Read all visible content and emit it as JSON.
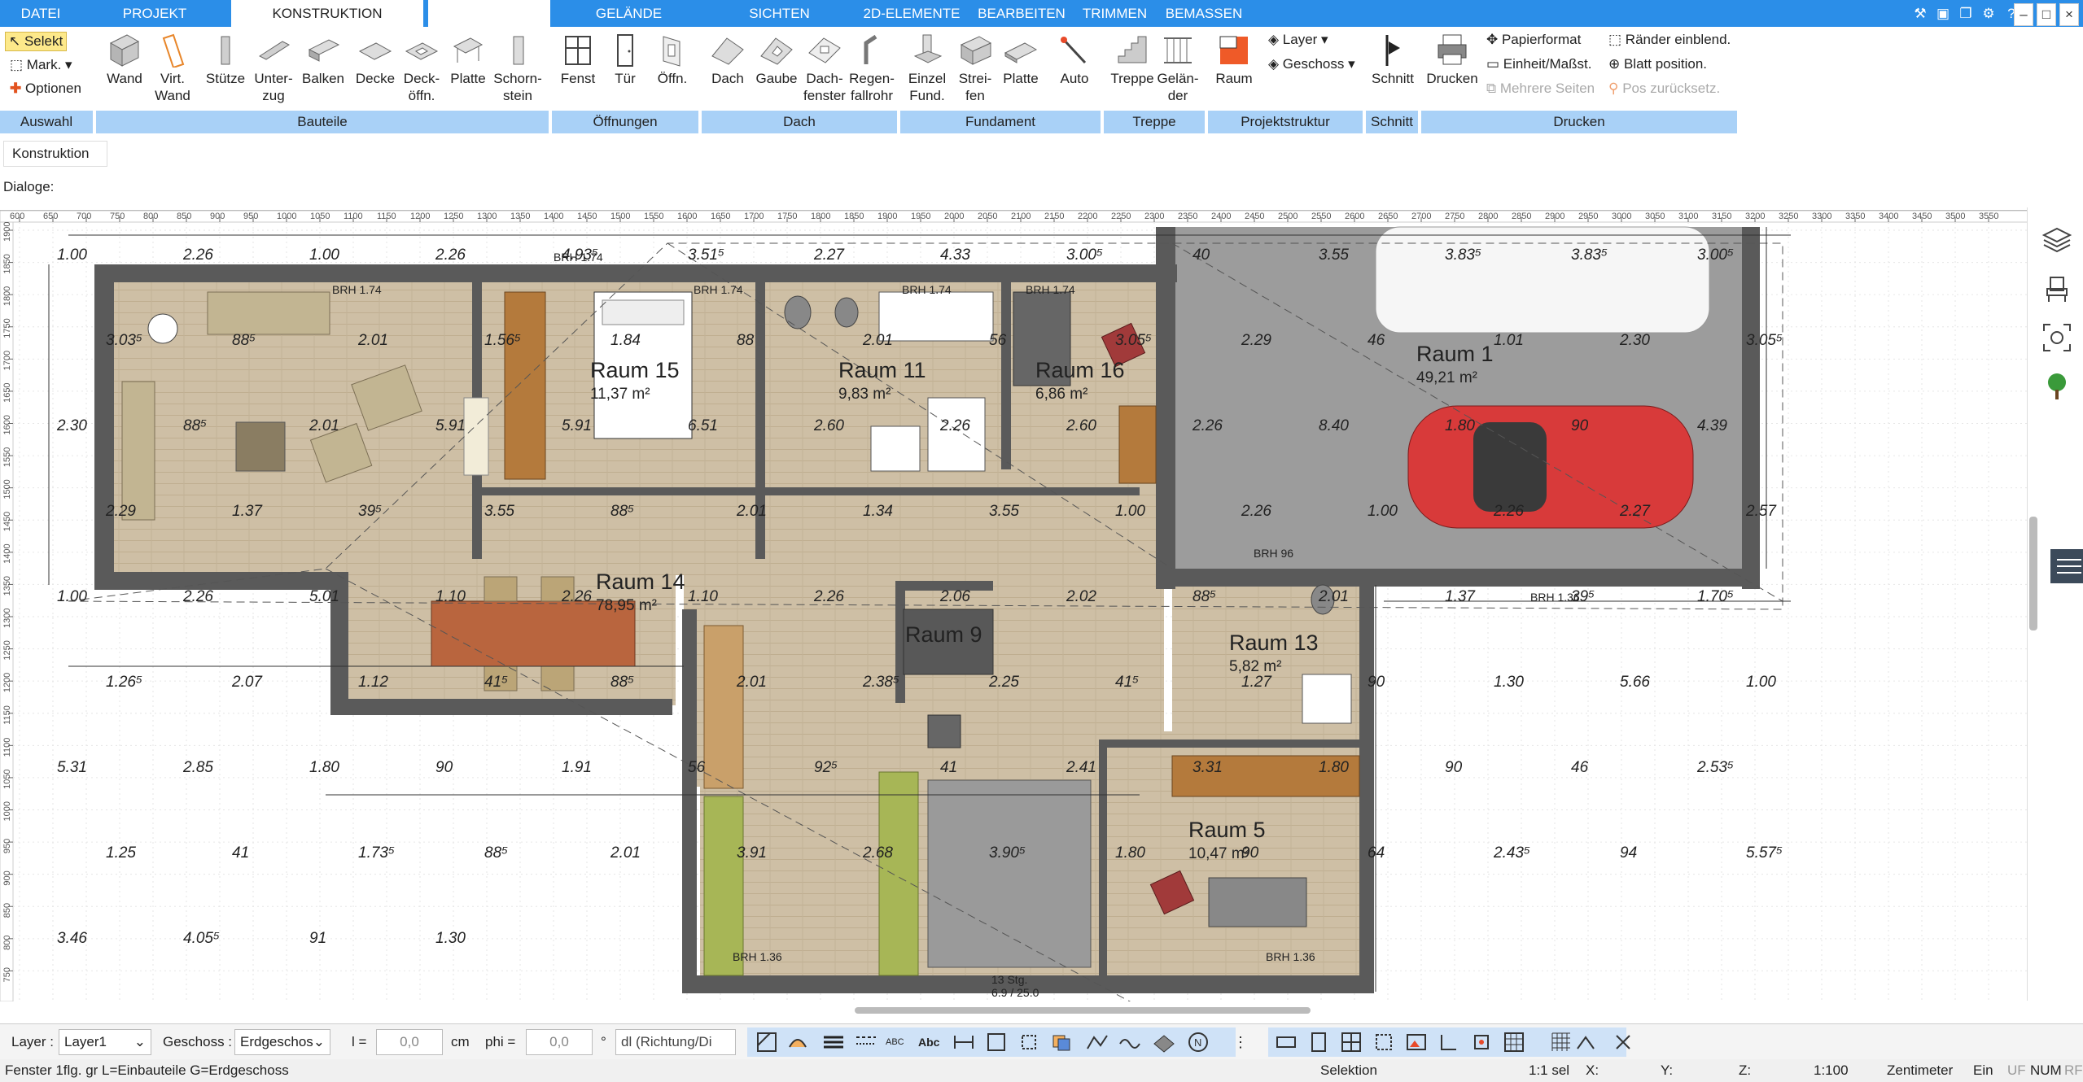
{
  "tabs": {
    "datei": "DATEI",
    "projekt": "PROJEKT",
    "konstruktion": "KONSTRUKTION",
    "gelaende": "GELÄNDE",
    "sichten": "SICHTEN",
    "elemente2d": "2D-ELEMENTE",
    "bearbeiten": "BEARBEITEN",
    "trimmen": "TRIMMEN",
    "bemassen": "BEMASSEN"
  },
  "ribbon": {
    "auswahl": {
      "selekt": "Selekt",
      "mark": "Mark.",
      "optionen": "Optionen"
    },
    "bauteile": {
      "wand": "Wand",
      "virt_wand_1": "Virt.",
      "virt_wand_2": "Wand",
      "stuetze": "Stütze",
      "unterzug_1": "Unter-",
      "unterzug_2": "zug",
      "balken": "Balken",
      "decke": "Decke",
      "deckoeffn_1": "Deck-",
      "deckoeffn_2": "öffn.",
      "platte": "Platte",
      "schornstein_1": "Schorn-",
      "schornstein_2": "stein"
    },
    "oeffnungen": {
      "fenst": "Fenst",
      "tuer": "Tür",
      "oeffn": "Öffn."
    },
    "dach": {
      "dach": "Dach",
      "gaube": "Gaube",
      "dachfenster_1": "Dach-",
      "dachfenster_2": "fenster",
      "regenfallrohr_1": "Regen-",
      "regenfallrohr_2": "fallrohr"
    },
    "fundament": {
      "einzel_1": "Einzel",
      "einzel_2": "Fund.",
      "streifen_1": "Strei-",
      "streifen_2": "fen",
      "platte": "Platte",
      "auto": "Auto"
    },
    "treppe": {
      "treppe": "Treppe",
      "gelaender_1": "Gelän-",
      "gelaender_2": "der"
    },
    "projektstruktur": {
      "raum": "Raum",
      "layer": "Layer",
      "geschoss": "Geschoss"
    },
    "schnitt": {
      "schnitt": "Schnitt"
    },
    "drucken": {
      "drucken": "Drucken",
      "papierformat": "Papierformat",
      "einheit": "Einheit/Maßst.",
      "mehrere": "Mehrere Seiten",
      "raender": "Ränder einblend.",
      "blatt": "Blatt position.",
      "pos": "Pos zurücksetz."
    }
  },
  "groups": {
    "auswahl": "Auswahl",
    "bauteile": "Bauteile",
    "oeffnungen": "Öffnungen",
    "dach": "Dach",
    "fundament": "Fundament",
    "treppe": "Treppe",
    "projektstruktur": "Projektstruktur",
    "schnitt": "Schnitt",
    "drucken": "Drucken"
  },
  "sidepanel": {
    "konstruktion": "Konstruktion",
    "dialoge": "Dialoge:"
  },
  "ruler_top": [
    "600",
    "650",
    "700",
    "750",
    "800",
    "850",
    "900",
    "950",
    "1000",
    "1050",
    "1100",
    "1150",
    "1200",
    "1250",
    "1300",
    "1350",
    "1400",
    "1450",
    "1500",
    "1550",
    "1600",
    "1650",
    "1700",
    "1750",
    "1800",
    "1850",
    "1900",
    "1950",
    "2000",
    "2050",
    "2100",
    "2150",
    "2200",
    "2250",
    "2300",
    "2350",
    "2400",
    "2450",
    "2500",
    "2550",
    "2600",
    "2650",
    "2700",
    "2750",
    "2800",
    "2850",
    "2900",
    "2950",
    "3000",
    "3050",
    "3100",
    "3150",
    "3200",
    "3250",
    "3300",
    "3350",
    "3400",
    "3450",
    "3500",
    "3550"
  ],
  "ruler_left": [
    "1900",
    "1850",
    "1800",
    "1750",
    "1700",
    "1650",
    "1600",
    "1550",
    "1500",
    "1450",
    "1400",
    "1350",
    "1300",
    "1250",
    "1200",
    "1150",
    "1100",
    "1050",
    "1000",
    "950",
    "900",
    "850",
    "800",
    "750"
  ],
  "plan": {
    "rooms": [
      {
        "name": "Raum 15",
        "area": "11,37 m²"
      },
      {
        "name": "Raum 11",
        "area": "9,83 m²"
      },
      {
        "name": "Raum 16",
        "area": "6,86 m²"
      },
      {
        "name": "Raum 1",
        "area": "49,21 m²"
      },
      {
        "name": "Raum 14",
        "area": "78,95 m²"
      },
      {
        "name": "Raum 9",
        "area": ""
      },
      {
        "name": "Raum 13",
        "area": "5,82 m²"
      },
      {
        "name": "Raum 5",
        "area": "10,47 m²"
      }
    ],
    "brh": [
      "BRH 1.74",
      "BRH 1.74",
      "BRH 1.74",
      "BRH 1.74",
      "BRH 1.74",
      "BRH 96",
      "BRH 1.36",
      "BRH 1.36",
      "BRH 1.36",
      "BRH 1.36",
      "BRH 1.36"
    ],
    "stairs": [
      "13 Stg.",
      "6.9 / 25.0"
    ],
    "dims": [
      "1.00",
      "2.26",
      "1.00",
      "2.26",
      "4.93⁵",
      "3.51⁵",
      "2.27",
      "4.33",
      "3.00⁵",
      "40",
      "3.55",
      "3.83⁵",
      "3.83⁵",
      "3.00⁵",
      "3.03⁵",
      "88⁵",
      "2.01",
      "1.56⁵",
      "1.84",
      "88",
      "2.01",
      "56",
      "3.05⁵",
      "2.29",
      "46",
      "1.01",
      "2.30",
      "3.05⁵",
      "2.30",
      "88⁵",
      "2.01",
      "5.91",
      "5.91",
      "6.51",
      "2.60",
      "2.26",
      "2.60",
      "2.26",
      "8.40",
      "1.80",
      "90",
      "4.39",
      "2.29",
      "1.37",
      "39⁵",
      "3.55",
      "88⁵",
      "2.01",
      "1.34",
      "3.55",
      "1.00",
      "2.26",
      "1.00",
      "2.26",
      "2.27",
      "2.57",
      "1.00",
      "2.26",
      "5.01",
      "1.10",
      "2.26",
      "1.10",
      "2.26",
      "2.06",
      "2.02",
      "88⁵",
      "2.01",
      "1.37",
      "39⁵",
      "1.70⁵",
      "1.26⁵",
      "2.07",
      "1.12",
      "41⁵",
      "88⁵",
      "2.01",
      "2.38⁵",
      "2.25",
      "41⁵",
      "1.27",
      "90",
      "1.30",
      "5.66",
      "1.00",
      "5.31",
      "2.85",
      "1.80",
      "90",
      "1.91",
      "56",
      "92⁵",
      "41",
      "2.41",
      "3.31",
      "1.80",
      "90",
      "46",
      "2.53⁵",
      "1.25",
      "41",
      "1.73⁵",
      "88⁵",
      "2.01",
      "3.91",
      "2.68",
      "3.90⁵",
      "1.80",
      "90",
      "64",
      "2.43⁵",
      "94",
      "5.57⁵",
      "3.46",
      "4.05⁵",
      "91",
      "1.30"
    ]
  },
  "bottom_toolbar": {
    "layer_label": "Layer :",
    "layer_value": "Layer1",
    "geschoss_label": "Geschoss :",
    "geschoss_value": "Erdgeschos",
    "l_label": "l =",
    "l_value": "0,0",
    "unit_cm": "cm",
    "phi_label": "phi =",
    "phi_value": "0,0",
    "deg": "°",
    "dl_value": "dl (Richtung/Di"
  },
  "statusbar": {
    "hint": "Fenster 1flg. gr L=Einbauteile G=Erdgeschoss",
    "mode": "Selektion",
    "sel": "1:1 sel",
    "x": "X:",
    "y": "Y:",
    "z": "Z:",
    "scale": "1:100",
    "unit": "Zentimeter",
    "ein": "Ein",
    "uf": "UF",
    "num": "NUM",
    "rf": "RF"
  },
  "colors": {
    "accent": "#2b8ee8",
    "group": "#a9d1f7",
    "floor": "#cdbfa6",
    "garage": "#9a9a9a",
    "wall": "#555555",
    "car": "#d83a3a"
  }
}
